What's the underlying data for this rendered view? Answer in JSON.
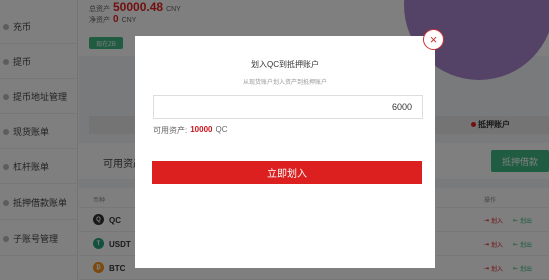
{
  "sidebar": {
    "items": [
      {
        "label": "充币"
      },
      {
        "label": "提币"
      },
      {
        "label": "提币地址管理"
      },
      {
        "label": "现货账单"
      },
      {
        "label": "杠杆账单"
      },
      {
        "label": "抵押借款账单"
      },
      {
        "label": "子账号管理"
      }
    ]
  },
  "summary": {
    "total_label": "总资产",
    "total_value": "50000.48",
    "total_unit": "CNY",
    "net_label": "净资产",
    "net_value": "0",
    "net_unit": "CNY",
    "small_button": "现在ZB"
  },
  "tabs": {
    "active_right": "抵押账户"
  },
  "sub": {
    "title": "可用资产",
    "button": "抵押借款"
  },
  "table": {
    "header_coin": "币种",
    "header_op": "操作",
    "rows": [
      {
        "coin": "QC",
        "in": "划入",
        "out": "划出"
      },
      {
        "coin": "USDT",
        "in": "划入",
        "out": "划出"
      },
      {
        "coin": "BTC",
        "in": "划入",
        "out": "划出"
      }
    ]
  },
  "modal": {
    "title": "划入QC到抵押账户",
    "subtitle": "从现货账户划入资产到抵押账户",
    "amount_value": "6000",
    "available_label": "可用资产:",
    "available_value": "10000",
    "available_unit": "QC",
    "confirm_label": "立即划入",
    "close_glyph": "×"
  },
  "colors": {
    "accent_red": "#dc1f1f",
    "accent_green": "#3fb883",
    "pie_purple": "#a985cf"
  },
  "icons": {
    "close": "close-icon",
    "qc": "qc-coin-icon",
    "usdt": "usdt-coin-icon",
    "btc": "btc-coin-icon"
  }
}
